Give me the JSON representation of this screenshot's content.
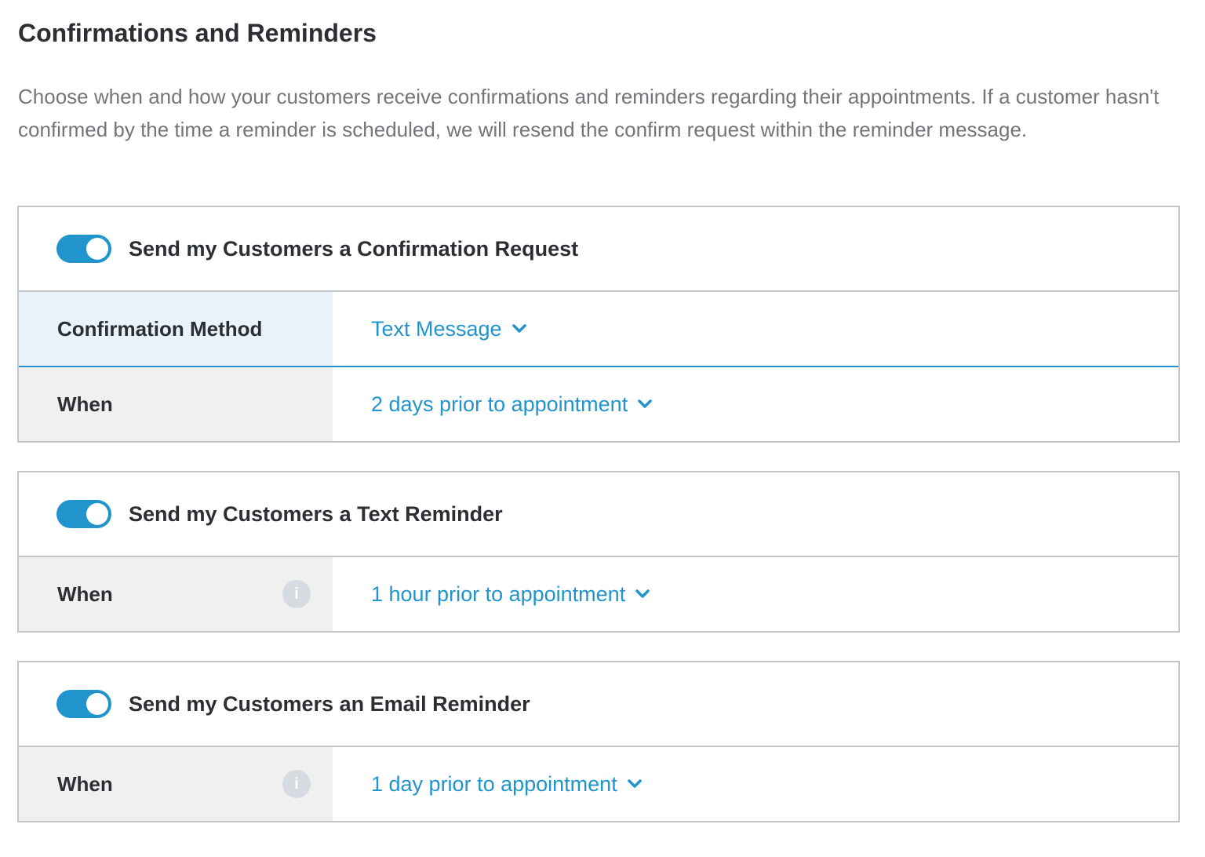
{
  "page": {
    "title": "Confirmations and Reminders",
    "description": "Choose when and how your customers receive confirmations and reminders regarding their appointments. If a customer hasn't confirmed by the time a reminder is scheduled, we will resend the confirm request within the reminder message."
  },
  "colors": {
    "accent": "#2294cd",
    "label_bg": "#f0f0f1",
    "active_bg": "#eaf3fb",
    "border": "#c4c7ca"
  },
  "sections": [
    {
      "label": "Send my Customers a Confirmation Request",
      "enabled": true,
      "rows": [
        {
          "label": "Confirmation Method",
          "value": "Text Message",
          "info": false
        },
        {
          "label": "When",
          "value": "2 days prior to appointment",
          "info": false
        }
      ]
    },
    {
      "label": "Send my Customers a Text Reminder",
      "enabled": true,
      "rows": [
        {
          "label": "When",
          "value": "1 hour prior to appointment",
          "info": true,
          "info_icon": "i"
        }
      ]
    },
    {
      "label": "Send my Customers an Email Reminder",
      "enabled": true,
      "rows": [
        {
          "label": "When",
          "value": "1 day prior to appointment",
          "info": true,
          "info_icon": "i"
        }
      ]
    }
  ]
}
